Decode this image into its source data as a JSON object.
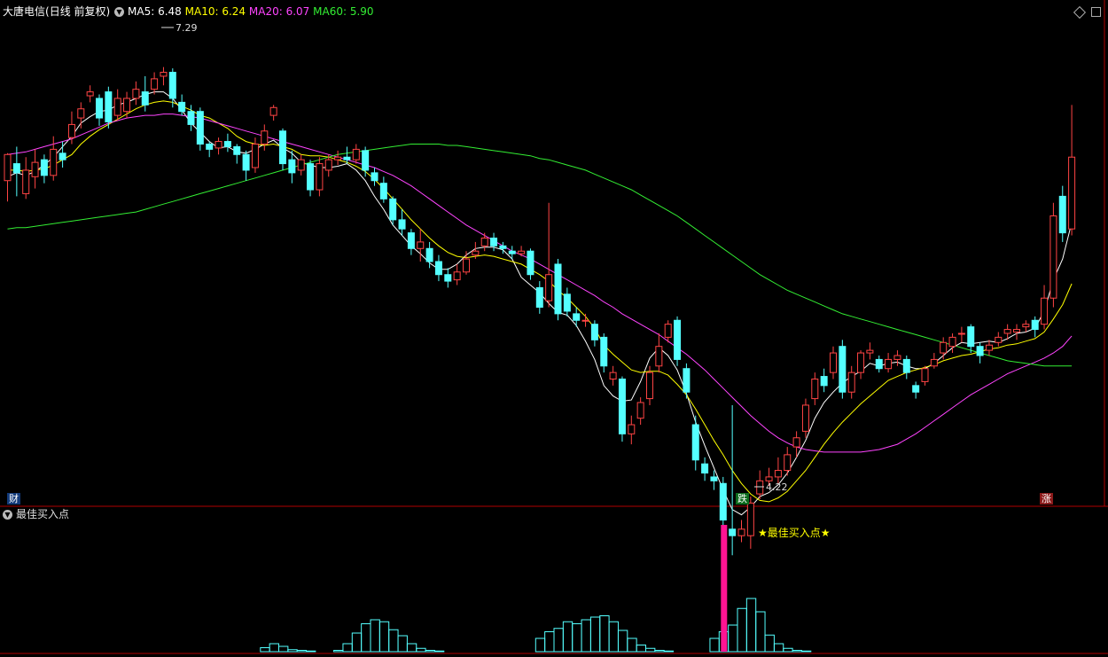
{
  "header": {
    "title": "大唐电信",
    "period": "(日线 前复权)",
    "ma": [
      {
        "label": "MA5:",
        "value": "6.48",
        "color": "#ffffff"
      },
      {
        "label": "MA10:",
        "value": "6.24",
        "color": "#ffff00"
      },
      {
        "label": "MA20:",
        "value": "6.07",
        "color": "#ff44ff"
      },
      {
        "label": "MA60:",
        "value": "5.90",
        "color": "#33ee33"
      }
    ]
  },
  "price_labels": {
    "high": "7.29",
    "low": "4.22"
  },
  "markers": {
    "cai": "财",
    "die": "跌",
    "zhang": "涨"
  },
  "indicator": {
    "title": "最佳买入点",
    "signal_label": "★最佳买入点★"
  },
  "colors": {
    "up": "#ff4444",
    "down": "#54ffff",
    "grid": "#b00000",
    "signal": "#ff1493"
  },
  "chart_data": {
    "type": "candlestick",
    "ylim": [
      4.0,
      7.6
    ],
    "candles": [
      [
        6.42,
        6.62,
        6.63,
        6.26
      ],
      [
        6.55,
        6.48,
        6.68,
        6.3
      ],
      [
        6.32,
        6.5,
        6.6,
        6.28
      ],
      [
        6.45,
        6.56,
        6.66,
        6.36
      ],
      [
        6.58,
        6.46,
        6.62,
        6.4
      ],
      [
        6.46,
        6.66,
        6.76,
        6.42
      ],
      [
        6.63,
        6.58,
        6.72,
        6.52
      ],
      [
        6.75,
        6.85,
        6.95,
        6.7
      ],
      [
        6.9,
        6.97,
        7.02,
        6.82
      ],
      [
        7.07,
        7.1,
        7.15,
        7.02
      ],
      [
        7.05,
        6.9,
        7.08,
        6.84
      ],
      [
        7.1,
        6.87,
        7.14,
        6.82
      ],
      [
        6.92,
        7.05,
        7.12,
        6.88
      ],
      [
        6.95,
        7.05,
        7.1,
        6.9
      ],
      [
        7.05,
        7.12,
        7.18,
        7.0
      ],
      [
        7.1,
        7.0,
        7.22,
        6.95
      ],
      [
        7.12,
        7.2,
        7.25,
        7.08
      ],
      [
        7.22,
        7.25,
        7.29,
        7.15
      ],
      [
        7.25,
        7.05,
        7.28,
        6.98
      ],
      [
        7.02,
        6.95,
        7.08,
        6.92
      ],
      [
        6.95,
        6.85,
        7.0,
        6.8
      ],
      [
        6.95,
        6.7,
        6.98,
        6.65
      ],
      [
        6.7,
        6.66,
        6.72,
        6.6
      ],
      [
        6.67,
        6.72,
        6.75,
        6.62
      ],
      [
        6.72,
        6.68,
        6.78,
        6.64
      ],
      [
        6.68,
        6.62,
        6.7,
        6.55
      ],
      [
        6.62,
        6.5,
        6.65,
        6.42
      ],
      [
        6.52,
        6.7,
        6.75,
        6.48
      ],
      [
        6.7,
        6.8,
        6.85,
        6.65
      ],
      [
        6.92,
        6.98,
        7.0,
        6.88
      ],
      [
        6.8,
        6.55,
        6.82,
        6.5
      ],
      [
        6.58,
        6.48,
        6.65,
        6.4
      ],
      [
        6.5,
        6.58,
        6.62,
        6.46
      ],
      [
        6.55,
        6.35,
        6.58,
        6.3
      ],
      [
        6.35,
        6.55,
        6.6,
        6.3
      ],
      [
        6.5,
        6.58,
        6.62,
        6.45
      ],
      [
        6.58,
        6.6,
        6.65,
        6.54
      ],
      [
        6.6,
        6.58,
        6.68,
        6.55
      ],
      [
        6.58,
        6.66,
        6.7,
        6.55
      ],
      [
        6.65,
        6.5,
        6.68,
        6.45
      ],
      [
        6.48,
        6.42,
        6.52,
        6.38
      ],
      [
        6.4,
        6.28,
        6.45,
        6.25
      ],
      [
        6.28,
        6.12,
        6.3,
        6.08
      ],
      [
        6.12,
        6.05,
        6.2,
        6.0
      ],
      [
        6.02,
        5.9,
        6.05,
        5.85
      ],
      [
        5.9,
        5.95,
        6.05,
        5.8
      ],
      [
        5.9,
        5.8,
        5.95,
        5.75
      ],
      [
        5.8,
        5.7,
        5.85,
        5.65
      ],
      [
        5.7,
        5.65,
        5.75,
        5.6
      ],
      [
        5.66,
        5.72,
        5.78,
        5.62
      ],
      [
        5.72,
        5.82,
        5.88,
        5.7
      ],
      [
        5.85,
        5.88,
        5.95,
        5.82
      ],
      [
        5.92,
        5.98,
        6.02,
        5.88
      ],
      [
        5.98,
        5.92,
        6.02,
        5.88
      ],
      [
        5.92,
        5.9,
        5.95,
        5.86
      ],
      [
        5.88,
        5.86,
        5.92,
        5.82
      ],
      [
        5.86,
        5.88,
        5.92,
        5.84
      ],
      [
        5.88,
        5.7,
        5.9,
        5.66
      ],
      [
        5.6,
        5.45,
        5.65,
        5.4
      ],
      [
        5.5,
        5.7,
        6.25,
        5.45
      ],
      [
        5.78,
        5.4,
        5.82,
        5.35
      ],
      [
        5.55,
        5.42,
        5.6,
        5.38
      ],
      [
        5.4,
        5.35,
        5.45,
        5.3
      ],
      [
        5.35,
        5.35,
        5.4,
        5.3
      ],
      [
        5.32,
        5.2,
        5.35,
        5.15
      ],
      [
        5.22,
        5.0,
        5.25,
        4.95
      ],
      [
        4.9,
        4.95,
        5.0,
        4.85
      ],
      [
        4.9,
        4.48,
        4.92,
        4.42
      ],
      [
        4.48,
        4.55,
        4.62,
        4.4
      ],
      [
        4.6,
        4.72,
        4.76,
        4.55
      ],
      [
        4.75,
        4.95,
        5.0,
        4.7
      ],
      [
        5.0,
        5.15,
        5.25,
        4.95
      ],
      [
        5.22,
        5.32,
        5.35,
        5.18
      ],
      [
        5.35,
        5.05,
        5.38,
        5.0
      ],
      [
        4.98,
        4.8,
        5.02,
        4.75
      ],
      [
        4.55,
        4.28,
        4.62,
        4.2
      ],
      [
        4.25,
        4.18,
        4.3,
        4.12
      ],
      [
        4.15,
        4.12,
        4.2,
        4.05
      ],
      [
        4.1,
        3.82,
        4.15,
        3.75
      ],
      [
        3.75,
        3.7,
        4.7,
        3.55
      ],
      [
        3.7,
        3.75,
        3.82,
        3.65
      ],
      [
        3.7,
        3.95,
        4.0,
        3.6
      ],
      [
        4.02,
        4.12,
        4.2,
        3.98
      ],
      [
        4.12,
        4.15,
        4.22,
        4.08
      ],
      [
        4.15,
        4.2,
        4.3,
        4.1
      ],
      [
        4.2,
        4.32,
        4.38,
        4.16
      ],
      [
        4.38,
        4.45,
        4.5,
        4.3
      ],
      [
        4.5,
        4.7,
        4.75,
        4.45
      ],
      [
        4.75,
        4.9,
        4.95,
        4.7
      ],
      [
        4.92,
        4.85,
        4.98,
        4.8
      ],
      [
        4.95,
        5.1,
        5.15,
        4.9
      ],
      [
        5.15,
        4.8,
        5.2,
        4.75
      ],
      [
        4.8,
        4.95,
        5.0,
        4.75
      ],
      [
        4.95,
        5.1,
        5.12,
        4.9
      ],
      [
        5.1,
        5.12,
        5.18,
        5.05
      ],
      [
        5.05,
        4.98,
        5.08,
        4.95
      ],
      [
        4.98,
        5.05,
        5.1,
        4.95
      ],
      [
        5.05,
        5.08,
        5.12,
        5.0
      ],
      [
        5.05,
        4.95,
        5.08,
        4.9
      ],
      [
        4.85,
        4.8,
        4.88,
        4.75
      ],
      [
        4.88,
        4.98,
        5.0,
        4.85
      ],
      [
        5.0,
        5.05,
        5.1,
        4.98
      ],
      [
        5.1,
        5.18,
        5.22,
        5.05
      ],
      [
        5.15,
        5.22,
        5.25,
        5.1
      ],
      [
        5.25,
        5.25,
        5.3,
        5.18
      ],
      [
        5.3,
        5.15,
        5.32,
        5.1
      ],
      [
        5.15,
        5.08,
        5.18,
        5.02
      ],
      [
        5.12,
        5.16,
        5.2,
        5.08
      ],
      [
        5.18,
        5.22,
        5.26,
        5.15
      ],
      [
        5.25,
        5.28,
        5.32,
        5.2
      ],
      [
        5.26,
        5.28,
        5.32,
        5.2
      ],
      [
        5.3,
        5.32,
        5.35,
        5.26
      ],
      [
        5.35,
        5.28,
        5.38,
        5.22
      ],
      [
        5.32,
        5.52,
        5.62,
        5.28
      ],
      [
        5.52,
        6.15,
        6.25,
        5.45
      ],
      [
        6.3,
        6.02,
        6.38,
        5.95
      ],
      [
        6.05,
        6.6,
        7.0,
        6.0
      ]
    ],
    "ma_series": [
      {
        "name": "MA5",
        "color": "#ffffff",
        "values": [
          6.45,
          6.48,
          6.46,
          6.49,
          6.54,
          6.6,
          6.68,
          6.76,
          6.86,
          6.91,
          6.95,
          6.96,
          7.0,
          7.02,
          7.05,
          7.08,
          7.1,
          7.1,
          7.05,
          6.96,
          6.86,
          6.79,
          6.72,
          6.67,
          6.68,
          6.64,
          6.63,
          6.66,
          6.7,
          6.73,
          6.67,
          6.63,
          6.56,
          6.54,
          6.52,
          6.52,
          6.53,
          6.55,
          6.5,
          6.42,
          6.3,
          6.2,
          6.08,
          6.0,
          5.92,
          5.86,
          5.79,
          5.74,
          5.74,
          5.78,
          5.85,
          5.9,
          5.91,
          5.91,
          5.89,
          5.82,
          5.68,
          5.62,
          5.56,
          5.48,
          5.41,
          5.39,
          5.31,
          5.19,
          5.05,
          4.85,
          4.77,
          4.73,
          4.74,
          4.88,
          5.06,
          5.14,
          5.08,
          4.97,
          4.79,
          4.57,
          4.39,
          4.22,
          4.05,
          3.9,
          3.86,
          3.92,
          4.0,
          4.03,
          4.09,
          4.18,
          4.3,
          4.43,
          4.6,
          4.72,
          4.8,
          4.87,
          4.92,
          4.96,
          5.02,
          5.0,
          5.02,
          5.03,
          5.0,
          4.98,
          4.98,
          5.02,
          5.08,
          5.14,
          5.18,
          5.17,
          5.18,
          5.19,
          5.18,
          5.21,
          5.25,
          5.26,
          5.29,
          5.42,
          5.66,
          5.82,
          6.1
        ]
      },
      {
        "name": "MA10",
        "color": "#ffff00",
        "values": [
          6.5,
          6.5,
          6.49,
          6.5,
          6.51,
          6.54,
          6.58,
          6.62,
          6.7,
          6.76,
          6.81,
          6.85,
          6.89,
          6.93,
          6.97,
          7.0,
          7.02,
          7.03,
          7.02,
          6.99,
          6.96,
          6.92,
          6.9,
          6.86,
          6.82,
          6.76,
          6.72,
          6.7,
          6.69,
          6.7,
          6.68,
          6.66,
          6.62,
          6.61,
          6.61,
          6.6,
          6.58,
          6.56,
          6.53,
          6.49,
          6.43,
          6.36,
          6.28,
          6.2,
          6.12,
          6.05,
          5.98,
          5.92,
          5.87,
          5.84,
          5.83,
          5.84,
          5.85,
          5.84,
          5.82,
          5.8,
          5.78,
          5.74,
          5.7,
          5.65,
          5.58,
          5.52,
          5.45,
          5.38,
          5.29,
          5.16,
          5.09,
          5.03,
          4.97,
          4.95,
          4.96,
          4.96,
          4.93,
          4.86,
          4.78,
          4.67,
          4.55,
          4.43,
          4.32,
          4.2,
          4.1,
          4.02,
          3.97,
          3.96,
          3.99,
          4.04,
          4.12,
          4.2,
          4.3,
          4.4,
          4.49,
          4.57,
          4.64,
          4.71,
          4.77,
          4.83,
          4.89,
          4.92,
          4.95,
          4.97,
          4.99,
          5.01,
          5.04,
          5.06,
          5.08,
          5.09,
          5.11,
          5.13,
          5.14,
          5.16,
          5.17,
          5.19,
          5.21,
          5.26,
          5.36,
          5.47,
          5.63
        ]
      },
      {
        "name": "MA20",
        "color": "#ff44ff",
        "values": [
          6.62,
          6.63,
          6.64,
          6.66,
          6.68,
          6.7,
          6.72,
          6.74,
          6.77,
          6.8,
          6.83,
          6.86,
          6.88,
          6.9,
          6.91,
          6.92,
          6.92,
          6.93,
          6.93,
          6.92,
          6.91,
          6.9,
          6.88,
          6.86,
          6.84,
          6.82,
          6.8,
          6.78,
          6.76,
          6.74,
          6.72,
          6.7,
          6.68,
          6.66,
          6.64,
          6.62,
          6.6,
          6.58,
          6.56,
          6.54,
          6.52,
          6.49,
          6.46,
          6.42,
          6.38,
          6.33,
          6.28,
          6.23,
          6.18,
          6.13,
          6.08,
          6.04,
          6.0,
          5.96,
          5.92,
          5.88,
          5.85,
          5.82,
          5.78,
          5.74,
          5.7,
          5.66,
          5.62,
          5.58,
          5.54,
          5.49,
          5.45,
          5.4,
          5.36,
          5.32,
          5.28,
          5.24,
          5.19,
          5.14,
          5.09,
          5.03,
          4.97,
          4.9,
          4.83,
          4.76,
          4.69,
          4.62,
          4.56,
          4.5,
          4.45,
          4.41,
          4.38,
          4.36,
          4.35,
          4.34,
          4.34,
          4.34,
          4.34,
          4.34,
          4.35,
          4.36,
          4.38,
          4.4,
          4.44,
          4.48,
          4.53,
          4.58,
          4.63,
          4.68,
          4.73,
          4.78,
          4.82,
          4.86,
          4.9,
          4.94,
          4.97,
          5.0,
          5.03,
          5.06,
          5.1,
          5.15,
          5.23
        ]
      },
      {
        "name": "MA60",
        "color": "#33ee33",
        "values": [
          6.05,
          6.06,
          6.06,
          6.07,
          6.08,
          6.09,
          6.1,
          6.11,
          6.12,
          6.13,
          6.14,
          6.15,
          6.16,
          6.17,
          6.18,
          6.2,
          6.22,
          6.24,
          6.26,
          6.28,
          6.3,
          6.32,
          6.34,
          6.36,
          6.38,
          6.4,
          6.42,
          6.44,
          6.46,
          6.48,
          6.5,
          6.52,
          6.54,
          6.56,
          6.58,
          6.6,
          6.62,
          6.63,
          6.64,
          6.65,
          6.66,
          6.67,
          6.68,
          6.69,
          6.7,
          6.7,
          6.7,
          6.7,
          6.69,
          6.69,
          6.68,
          6.67,
          6.66,
          6.65,
          6.64,
          6.63,
          6.62,
          6.61,
          6.59,
          6.58,
          6.56,
          6.54,
          6.52,
          6.5,
          6.47,
          6.44,
          6.41,
          6.38,
          6.35,
          6.31,
          6.27,
          6.23,
          6.19,
          6.15,
          6.1,
          6.05,
          6.0,
          5.95,
          5.9,
          5.85,
          5.8,
          5.75,
          5.7,
          5.66,
          5.62,
          5.58,
          5.55,
          5.52,
          5.49,
          5.46,
          5.43,
          5.4,
          5.38,
          5.36,
          5.34,
          5.32,
          5.3,
          5.28,
          5.26,
          5.24,
          5.22,
          5.2,
          5.18,
          5.16,
          5.14,
          5.12,
          5.1,
          5.08,
          5.06,
          5.04,
          5.03,
          5.02,
          5.01,
          5.0,
          5.0,
          5.0,
          5.0
        ]
      }
    ],
    "indicator_bars": [
      0,
      0,
      0,
      0,
      0,
      0,
      0,
      0,
      0,
      0,
      0,
      0,
      0,
      0,
      0,
      0,
      0,
      0,
      0,
      0,
      0,
      0,
      0,
      0,
      0,
      0,
      0,
      0,
      0,
      0,
      0,
      0,
      0,
      0,
      0,
      0,
      0,
      0,
      0,
      0,
      0,
      0,
      0,
      0,
      0,
      0,
      0,
      0,
      0,
      0,
      0,
      0,
      0,
      0,
      0,
      0,
      0,
      0,
      0,
      0,
      0,
      0,
      0,
      0,
      0,
      0,
      0,
      0,
      0,
      0,
      0,
      0,
      0,
      0,
      0,
      0,
      0,
      0,
      0,
      0,
      0,
      0,
      0,
      0,
      0,
      0,
      0,
      0,
      0,
      0,
      0,
      0,
      0,
      0,
      0,
      0,
      0,
      0,
      0,
      0,
      0,
      0,
      0,
      0,
      0,
      0,
      0,
      0,
      0,
      0,
      0,
      0,
      0,
      0,
      0,
      0,
      0
    ],
    "indicator_series": [
      0,
      0,
      0,
      0,
      0,
      0,
      0,
      0,
      0,
      0,
      0,
      0,
      0,
      0,
      0,
      0,
      0,
      0,
      0,
      0,
      0,
      0,
      0,
      0,
      0,
      0,
      0,
      0,
      0.06,
      0.12,
      0.08,
      0.03,
      0.02,
      0.01,
      0,
      0,
      0.02,
      0.12,
      0.28,
      0.42,
      0.48,
      0.45,
      0.33,
      0.24,
      0.12,
      0.05,
      0.02,
      0.01,
      0,
      0,
      0,
      0,
      0,
      0,
      0,
      0,
      0,
      0,
      0.2,
      0.3,
      0.35,
      0.45,
      0.42,
      0.48,
      0.52,
      0.54,
      0.45,
      0.32,
      0.2,
      0.1,
      0.05,
      0.02,
      0.01,
      0,
      0,
      0,
      0,
      0.2,
      0.3,
      0.4,
      0.65,
      0.8,
      0.6,
      0.25,
      0.12,
      0.05,
      0.02,
      0.01,
      0,
      0,
      0,
      0,
      0,
      0,
      0,
      0,
      0,
      0,
      0,
      0,
      0,
      0,
      0,
      0,
      0,
      0,
      0,
      0,
      0,
      0,
      0,
      0,
      0,
      0,
      0,
      0,
      0
    ],
    "signal_index": 78,
    "indicator_ylim": [
      0,
      1
    ]
  }
}
